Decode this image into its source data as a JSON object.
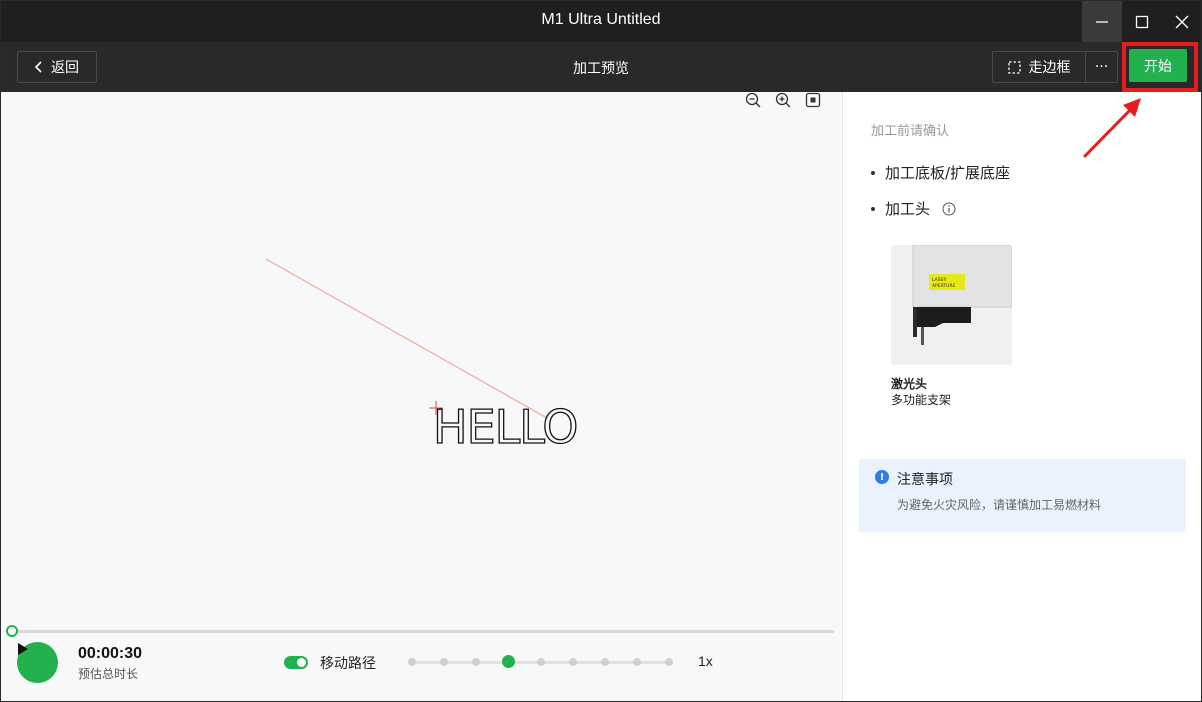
{
  "window": {
    "title": "M1 Ultra Untitled",
    "controls": {
      "minimize": "minimize-icon",
      "maximize": "maximize-icon",
      "close": "close-icon"
    }
  },
  "toolbar": {
    "back_label": "返回",
    "title": "加工预览",
    "frame_label": "走边框",
    "more_label": "···",
    "start_label": "开始"
  },
  "canvas": {
    "text_object": "HELLO"
  },
  "playback": {
    "time": "00:00:30",
    "time_label": "预估总时长",
    "progress": 0,
    "path_toggle_label": "移动路径",
    "path_toggle_on": true,
    "speed_steps": 9,
    "speed_active_index": 3,
    "speed_label": "1x"
  },
  "panel": {
    "confirm_label": "加工前请确认",
    "items": [
      {
        "label": "加工底板/扩展底座",
        "has_info": false
      },
      {
        "label": "加工头",
        "has_info": true
      }
    ],
    "head_card": {
      "image_text": "LASER APERTURE",
      "name": "激光头",
      "sub": "多功能支架"
    },
    "notice": {
      "title": "注意事项",
      "text": "为避免火灾风险，请谨慎加工易燃材料"
    }
  },
  "colors": {
    "accent": "#22b14c",
    "titlebar": "#1f1f21",
    "toolbar": "#29292b",
    "canvas_bg": "#f7f8fa",
    "notice_bg": "#eaf2fd",
    "annotation": "#e41e1e"
  }
}
